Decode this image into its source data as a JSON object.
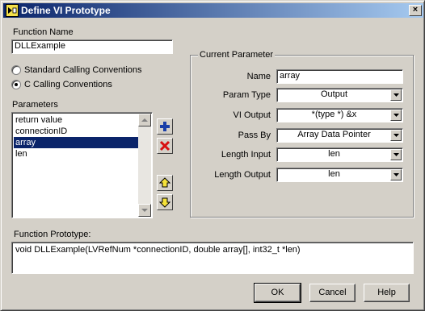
{
  "window": {
    "title": "Define VI Prototype",
    "close_glyph": "×"
  },
  "function_name": {
    "label": "Function Name",
    "value": "DLLExample"
  },
  "calling": {
    "standard_label": "Standard Calling Conventions",
    "c_label": "C Calling Conventions",
    "selected": "c"
  },
  "parameters": {
    "label": "Parameters",
    "items": [
      "return value",
      "connectionID",
      "array",
      "len"
    ],
    "selected_index": 2
  },
  "current_parameter": {
    "title": "Current Parameter",
    "name_label": "Name",
    "name_value": "array",
    "param_type_label": "Param Type",
    "param_type_value": "Output",
    "vi_output_label": "VI Output",
    "vi_output_value": "*(type *) &x",
    "pass_by_label": "Pass By",
    "pass_by_value": "Array Data Pointer",
    "length_input_label": "Length Input",
    "length_input_value": "len",
    "length_output_label": "Length Output",
    "length_output_value": "len"
  },
  "prototype": {
    "label": "Function Prototype:",
    "value": "void DLLExample(LVRefNum *connectionID, double array[], int32_t *len)"
  },
  "buttons": {
    "ok": "OK",
    "cancel": "Cancel",
    "help": "Help"
  },
  "icons": {
    "title": "labview-icon",
    "add": "plus-icon",
    "delete": "delete-x-icon",
    "move_up": "arrow-up-icon",
    "move_down": "arrow-down-icon"
  },
  "colors": {
    "title_start": "#0a246a",
    "title_end": "#a6caf0",
    "selection": "#0a246a",
    "face": "#d4d0c8"
  }
}
